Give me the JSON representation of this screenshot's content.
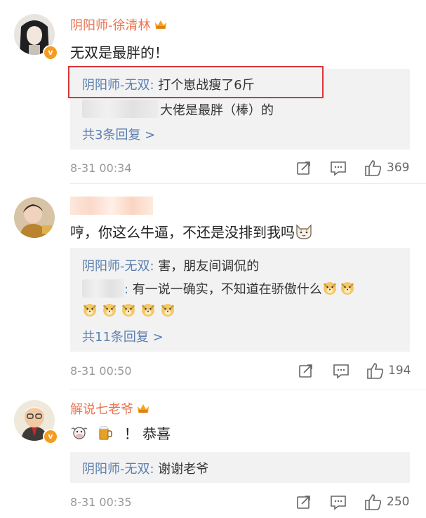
{
  "comments": [
    {
      "user": "阴阳师-徐清林",
      "verified": "v",
      "text": "无双是最胖的！",
      "replies": [
        {
          "name": "阴阳师-无双",
          "sep": ": ",
          "text": "打个崽战瘦了6斤"
        },
        {
          "name": "",
          "sep": "",
          "text": "大佬是最胖（棒）的"
        }
      ],
      "more": "共3条回复 >",
      "date": "8-31 00:34",
      "likes": "369"
    },
    {
      "user": "",
      "verified": "",
      "text": "哼，你这么牛逼，不还是没排到我吗",
      "replies": [
        {
          "name": "阴阳师-无双",
          "sep": ": ",
          "text": "害，朋友间调侃的"
        },
        {
          "name": "",
          "sep": ": ",
          "text": "有一说一确实，不知道在骄傲什么"
        }
      ],
      "more": "共11条回复 >",
      "date": "8-31 00:50",
      "likes": "194"
    },
    {
      "user": "解说七老爷",
      "verified": "v",
      "text": "！ 恭喜",
      "replies": [
        {
          "name": "阴阳师-无双",
          "sep": ": ",
          "text": "谢谢老爷"
        }
      ],
      "date": "8-31 00:35",
      "likes": "250"
    }
  ],
  "icons": {
    "share": "share-icon",
    "comment": "comment-icon",
    "like": "like-icon",
    "crown": "vip-crown-icon",
    "cat": "cat-emoji",
    "doge": "doge-emoji",
    "cow": "cow-emoji",
    "beer": "beer-emoji"
  },
  "colors": {
    "username": "#eb7350",
    "reply_name": "#5b7fb0",
    "highlight": "#d9343b",
    "badge": "#f59b1f"
  }
}
